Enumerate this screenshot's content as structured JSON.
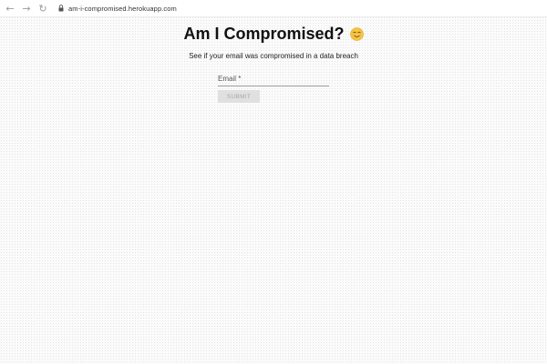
{
  "browser": {
    "url": "am-i-compromised.herokuapp.com",
    "icons": [
      "back-icon",
      "forward-icon",
      "reload-icon",
      "lock-icon"
    ]
  },
  "page": {
    "title": "Am I Compromised?",
    "title_emoji": "smiley-icon",
    "subtitle": "See if your email was compromised in a data breach"
  },
  "form": {
    "email_label": "Email *",
    "email_value": "",
    "submit_label": "SUBMIT"
  }
}
